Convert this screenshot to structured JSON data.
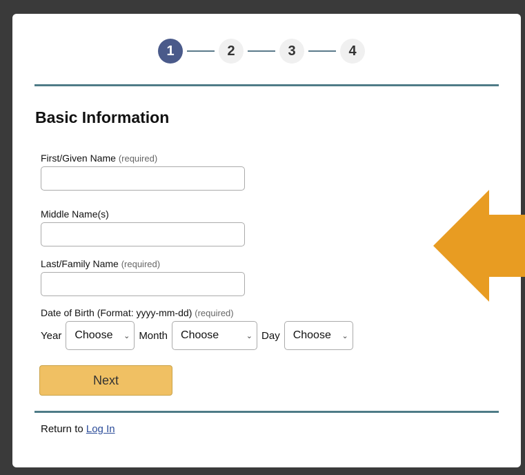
{
  "stepper": {
    "steps": [
      "1",
      "2",
      "3",
      "4"
    ],
    "active_step": 1
  },
  "form": {
    "title": "Basic Information",
    "fields": {
      "first": {
        "label": "First/Given Name",
        "note": "(required)",
        "value": ""
      },
      "middle": {
        "label": "Middle Name(s)",
        "note": "",
        "value": ""
      },
      "last": {
        "label": "Last/Family Name",
        "note": "(required)",
        "value": ""
      }
    },
    "dob": {
      "label": "Date of Birth (Format: yyyy-mm-dd)",
      "note": "(required)",
      "year_label": "Year",
      "month_label": "Month",
      "day_label": "Day",
      "year_value": "Choose",
      "month_value": "Choose",
      "day_value": "Choose"
    },
    "next_label": "Next"
  },
  "footer": {
    "text": "Return to",
    "link": "Log In"
  },
  "colors": {
    "step_active": "#4a5a8a",
    "rule": "#4e7b87",
    "next_button": "#f0c063",
    "arrow": "#e89c22"
  },
  "annotation": {
    "icon": "arrow-left-icon"
  }
}
